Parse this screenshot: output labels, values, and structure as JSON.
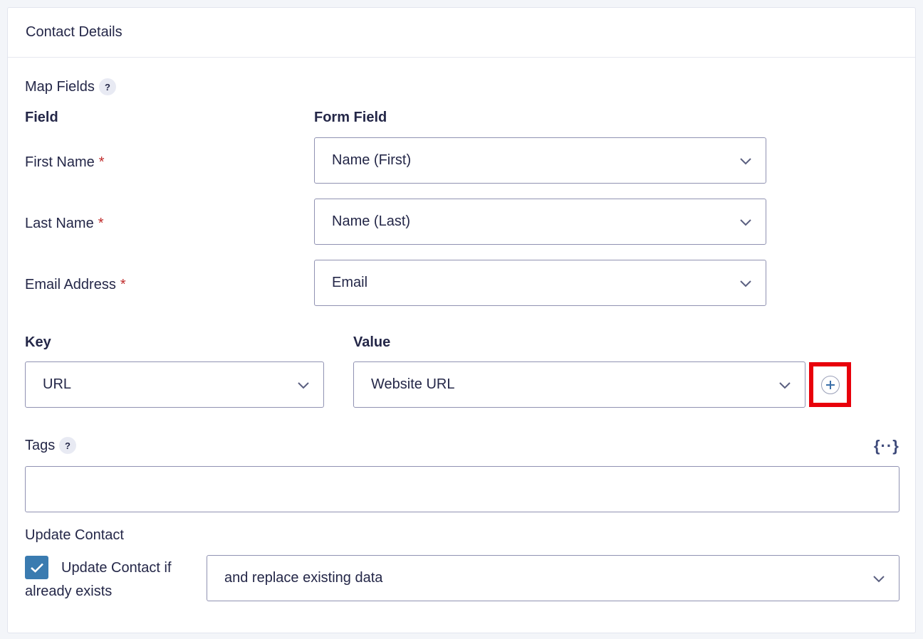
{
  "panel": {
    "title": "Contact Details"
  },
  "map_fields": {
    "label": "Map Fields",
    "help": "?",
    "col_field": "Field",
    "col_form_field": "Form Field",
    "required_mark": "*",
    "rows": [
      {
        "field": "First Name",
        "value": "Name (First)"
      },
      {
        "field": "Last Name",
        "value": "Name (Last)"
      },
      {
        "field": "Email Address",
        "value": "Email"
      }
    ]
  },
  "custom_fields": {
    "key_label": "Key",
    "value_label": "Value",
    "key_value": "URL",
    "value_value": "Website URL"
  },
  "tags": {
    "label": "Tags",
    "help": "?",
    "value": "",
    "merge_icon": "{··}"
  },
  "update": {
    "label": "Update Contact",
    "checkbox_label_line1": "Update Contact if",
    "checkbox_label_line2": "already exists",
    "checked": true,
    "mode": "and replace existing data"
  },
  "colors": {
    "accent": "#3a7bb0",
    "highlight": "#e8000b",
    "required": "#c02b2b"
  }
}
